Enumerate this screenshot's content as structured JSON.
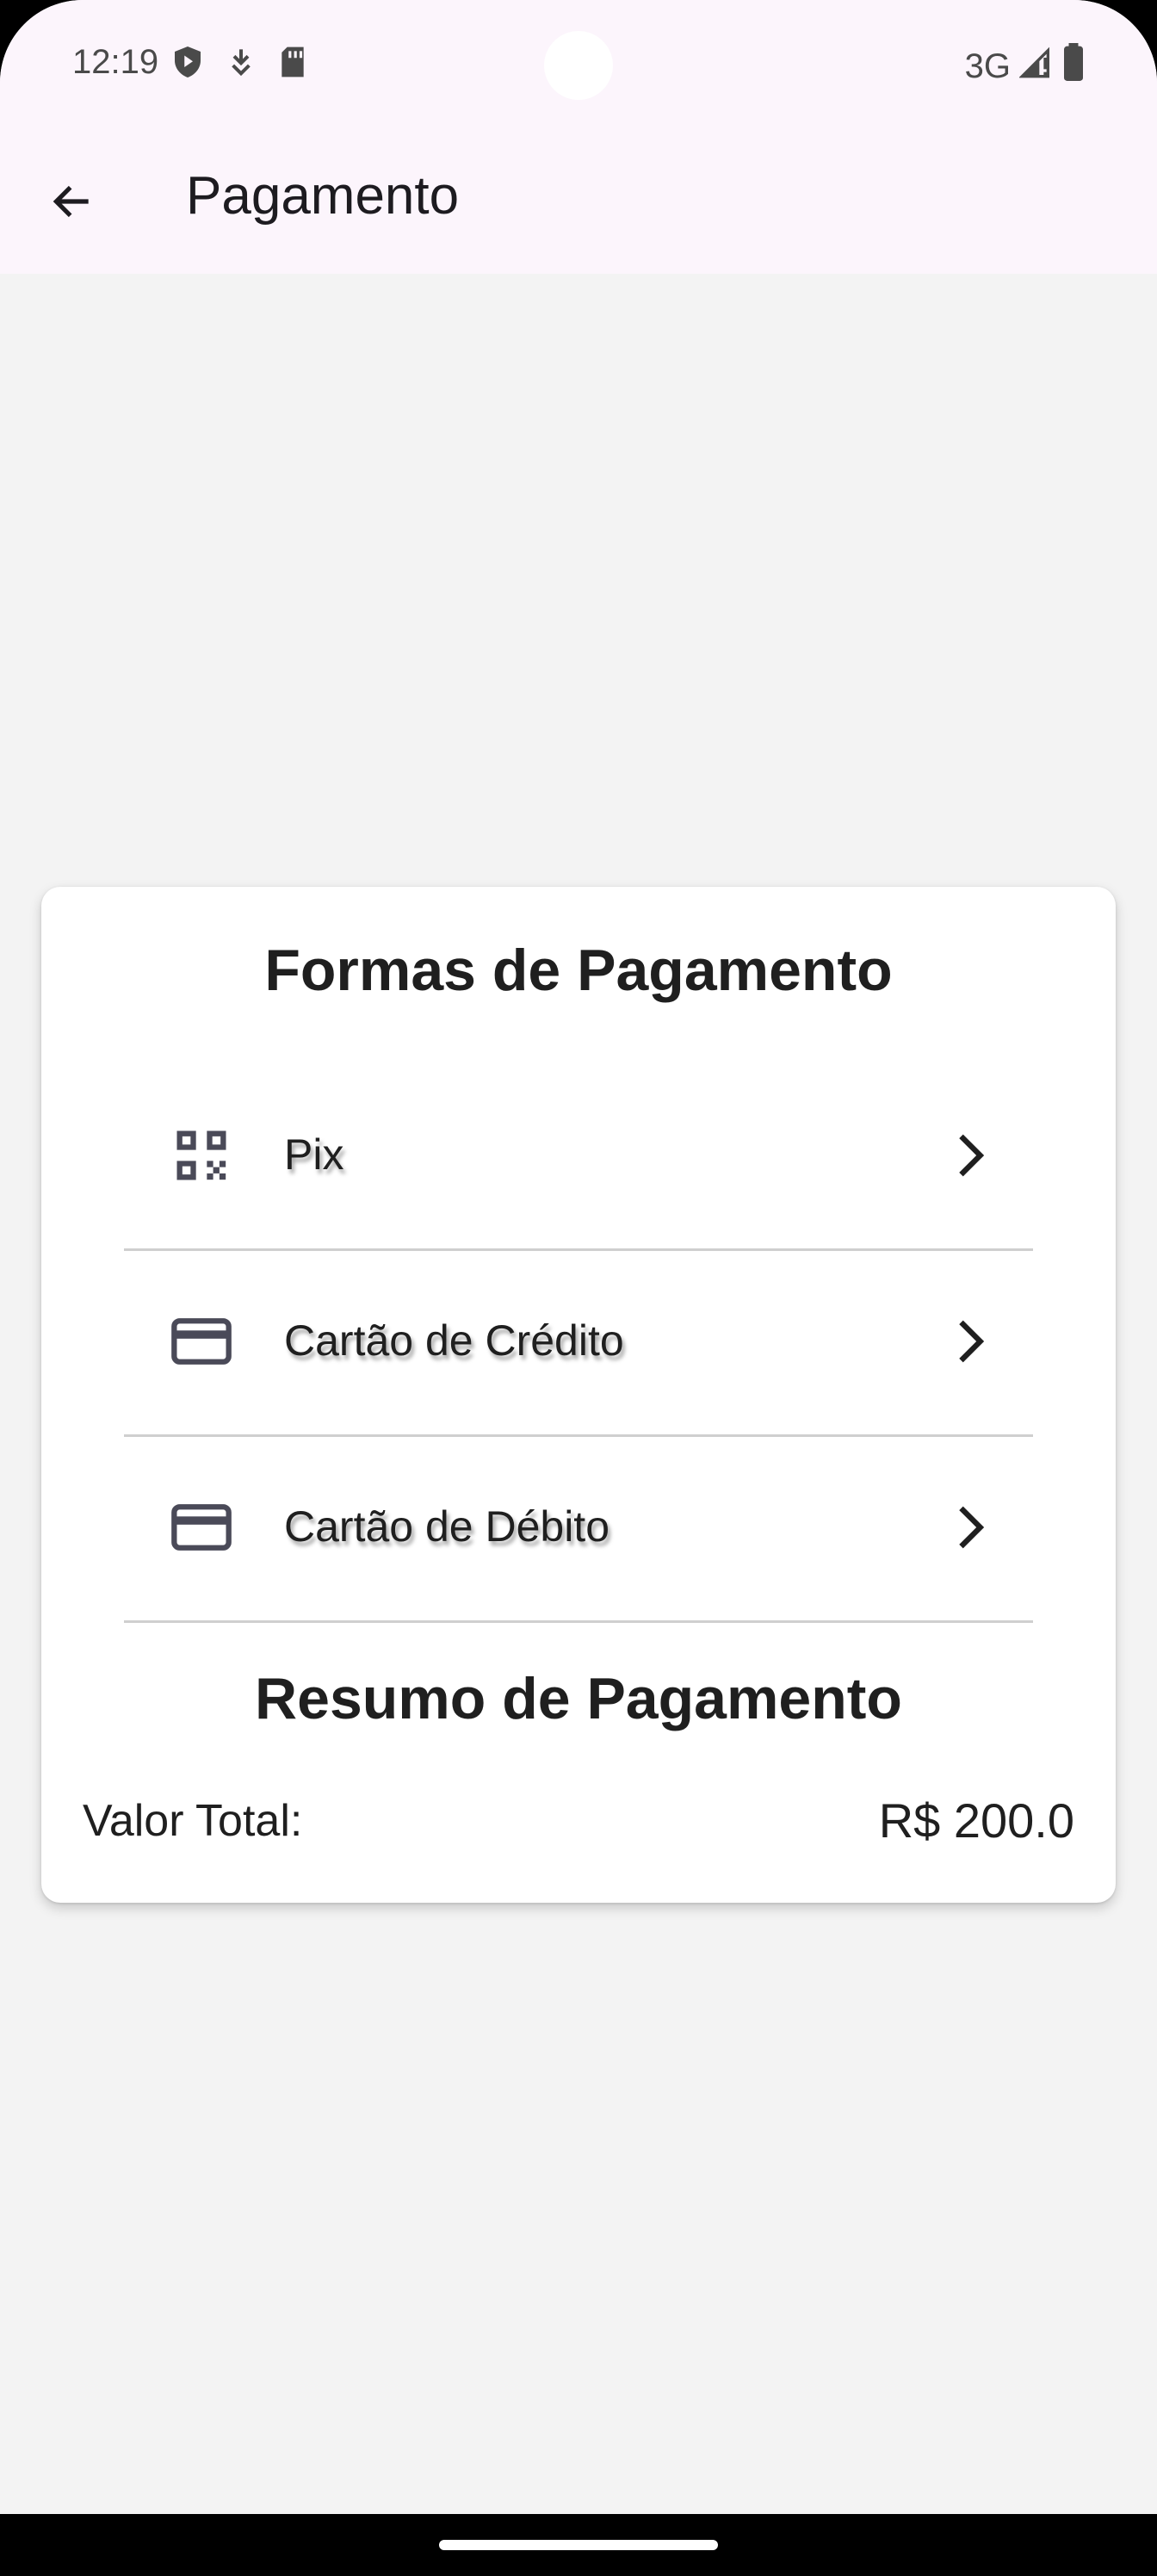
{
  "status_bar": {
    "time": "12:19",
    "network": "3G",
    "left_icons": [
      "shield-play-icon",
      "download-icon",
      "sd-card-icon"
    ],
    "right_icons": [
      "signal-icon",
      "battery-icon"
    ]
  },
  "app_bar": {
    "title": "Pagamento",
    "back_icon": "arrow-back-icon"
  },
  "payment_methods": {
    "title": "Formas de Pagamento",
    "items": [
      {
        "label": "Pix",
        "icon": "qr-code-icon"
      },
      {
        "label": "Cartão de Crédito",
        "icon": "credit-card-icon"
      },
      {
        "label": "Cartão de Débito",
        "icon": "credit-card-icon"
      }
    ]
  },
  "summary": {
    "title": "Resumo de Pagamento",
    "total_label": "Valor Total:",
    "total_value": "R$ 200.0"
  },
  "colors": {
    "app_bar_bg": "#fcf5fc",
    "page_bg": "#f3f3f3",
    "card_bg": "#ffffff",
    "icon_color": "#4a4a58"
  }
}
